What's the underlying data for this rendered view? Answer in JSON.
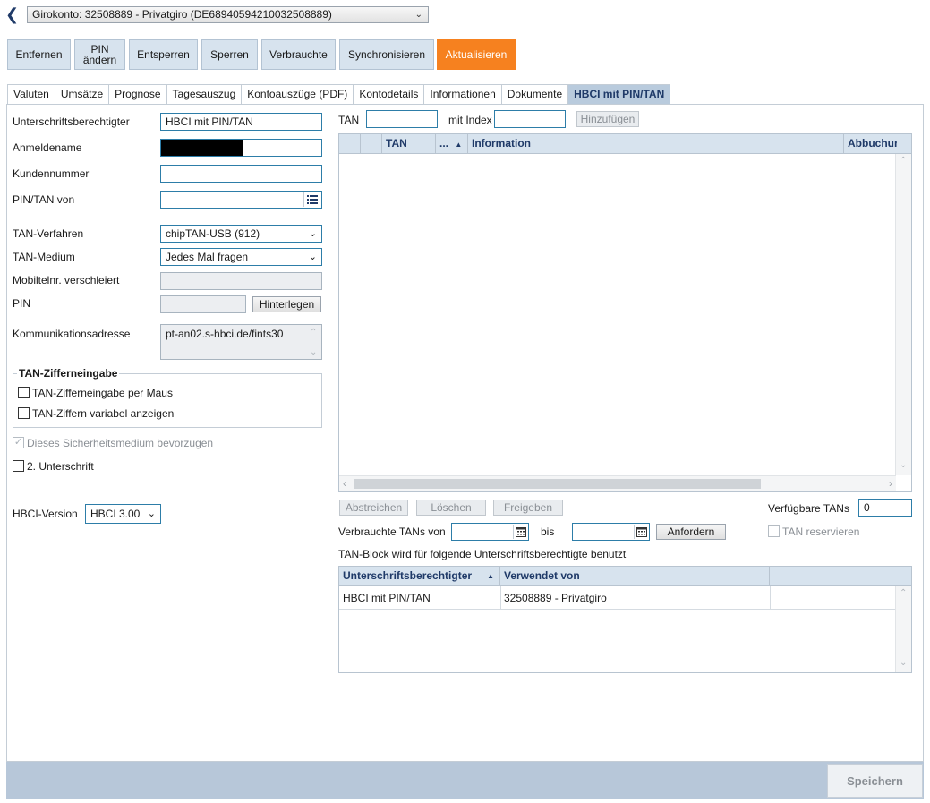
{
  "account": {
    "label": "Girokonto: 32508889 - Privatgiro (DE68940594210032508889)"
  },
  "toolbar": {
    "remove": "Entfernen",
    "pin_change_1": "PIN",
    "pin_change_2": "ändern",
    "unlock": "Entsperren",
    "lock": "Sperren",
    "used": "Verbrauchte",
    "sync": "Synchronisieren",
    "refresh": "Aktualisieren"
  },
  "tabs": [
    "Valuten",
    "Umsätze",
    "Prognose",
    "Tagesauszug",
    "Kontoauszüge (PDF)",
    "Kontodetails",
    "Informationen",
    "Dokumente",
    "HBCI mit PIN/TAN"
  ],
  "form": {
    "signatory_label": "Unterschriftsberechtigter",
    "signatory_value": "HBCI mit PIN/TAN",
    "login_label": "Anmeldename",
    "customer_label": "Kundennummer",
    "pintan_label": "PIN/TAN von",
    "tan_method_label": "TAN-Verfahren",
    "tan_method_value": "chipTAN-USB (912)",
    "tan_medium_label": "TAN-Medium",
    "tan_medium_value": "Jedes Mal fragen",
    "mobile_label": "Mobiltelnr. verschleiert",
    "pin_label": "PIN",
    "deposit_button": "Hinterlegen",
    "comm_label": "Kommunikationsadresse",
    "comm_value": "pt-an02.s-hbci.de/fints30",
    "group_title": "TAN-Zifferneingabe",
    "mouse_input": "TAN-Zifferneingabe per Maus",
    "variable_digits": "TAN-Ziffern variabel anzeigen",
    "prefer_medium": "Dieses Sicherheitsmedium bevorzugen",
    "second_signature": "2. Unterschrift",
    "hbci_version_label": "HBCI-Version",
    "hbci_version_value": "HBCI 3.00"
  },
  "tan": {
    "tan_label": "TAN",
    "index_label": "mit Index",
    "add_button": "Hinzufügen",
    "grid_cols": [
      "TAN",
      "...",
      "Information",
      "Abbuchur"
    ],
    "strike_button": "Abstreichen",
    "delete_button": "Löschen",
    "release_button": "Freigeben",
    "available_label": "Verfügbare TANs",
    "available_value": "0",
    "used_from_label": "Verbrauchte TANs von",
    "to_label": "bis",
    "request_button": "Anfordern",
    "reserve_label": "TAN reservieren",
    "block_info": "TAN-Block wird für folgende Unterschriftsberechtigte benutzt",
    "sig_cols": [
      "Unterschriftsberechtigter",
      "Verwendet von"
    ],
    "sig_rows": [
      {
        "signatory": "HBCI mit PIN/TAN",
        "used_by": "32508889 - Privatgiro"
      }
    ]
  },
  "footer": {
    "save": "Speichern"
  },
  "colors": {
    "accent": "#f6811f",
    "toolbar": "#d7e3ee",
    "header_blue": "#1f3a68",
    "footer": "#b7c7d9"
  }
}
